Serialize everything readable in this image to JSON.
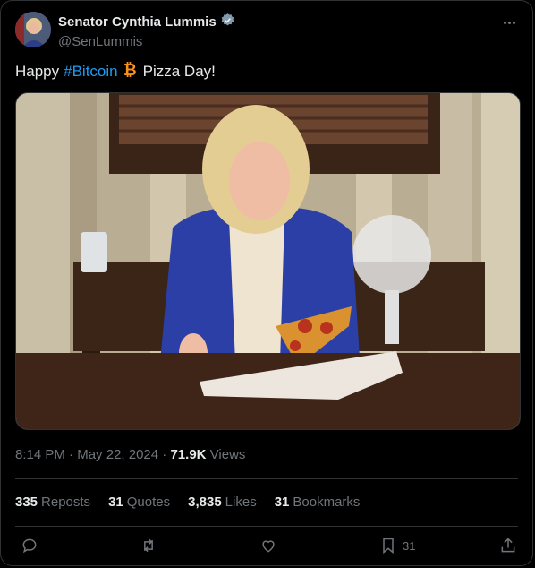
{
  "author": {
    "display_name": "Senator Cynthia Lummis",
    "handle": "@SenLummis",
    "verified": true
  },
  "tweet": {
    "text_prefix": "Happy",
    "hashtag": "#Bitcoin",
    "text_suffix": "Pizza Day!"
  },
  "meta": {
    "time": "8:14 PM",
    "date": "May 22, 2024",
    "views_count": "71.9K",
    "views_label": "Views"
  },
  "stats": {
    "reposts_count": "335",
    "reposts_label": "Reposts",
    "quotes_count": "31",
    "quotes_label": "Quotes",
    "likes_count": "3,835",
    "likes_label": "Likes",
    "bookmarks_count": "31",
    "bookmarks_label": "Bookmarks"
  },
  "actions": {
    "bookmark_count": "31"
  },
  "icons": [
    "verified-icon",
    "more-icon",
    "bitcoin-icon",
    "reply-icon",
    "repost-icon",
    "like-icon",
    "bookmark-icon",
    "share-icon"
  ],
  "colors": {
    "accent": "#1d9bf0",
    "bitcoin": "#f7931a",
    "muted": "#71767b",
    "text": "#e7e9ea"
  }
}
